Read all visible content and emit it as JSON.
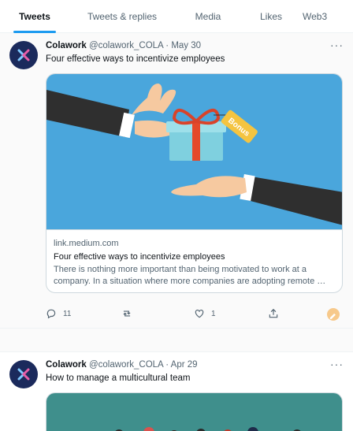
{
  "tabs": [
    {
      "label": "Tweets",
      "active": true
    },
    {
      "label": "Tweets & replies",
      "active": false
    },
    {
      "label": "Media",
      "active": false
    },
    {
      "label": "Likes",
      "active": false
    },
    {
      "label": "Web3",
      "active": false
    }
  ],
  "accent_color": "#1d9bf0",
  "tweets": [
    {
      "name": "Colawork",
      "meta": "@colawork_COLA · May 30",
      "more_icon": "more-dots-icon",
      "text": "Four effective ways to incentivize employees",
      "card": {
        "image": "hand-giving-gift-illustration",
        "gift_tag": "Bonus",
        "domain": "link.medium.com",
        "title": "Four effective ways to incentivize employees",
        "desc_line1": "There is nothing more important than being motivated to work at a",
        "desc_line2": "company. In a situation where more companies are adopting remote …"
      },
      "actions": {
        "reply_count": "11",
        "retweet_count": "",
        "like_count": "1"
      }
    },
    {
      "name": "Colawork",
      "meta": "@colawork_COLA · Apr 29",
      "more_icon": "more-dots-icon",
      "text": "How to manage a multicultural team",
      "card": {
        "image": "multicultural-team-illustration"
      }
    }
  ]
}
